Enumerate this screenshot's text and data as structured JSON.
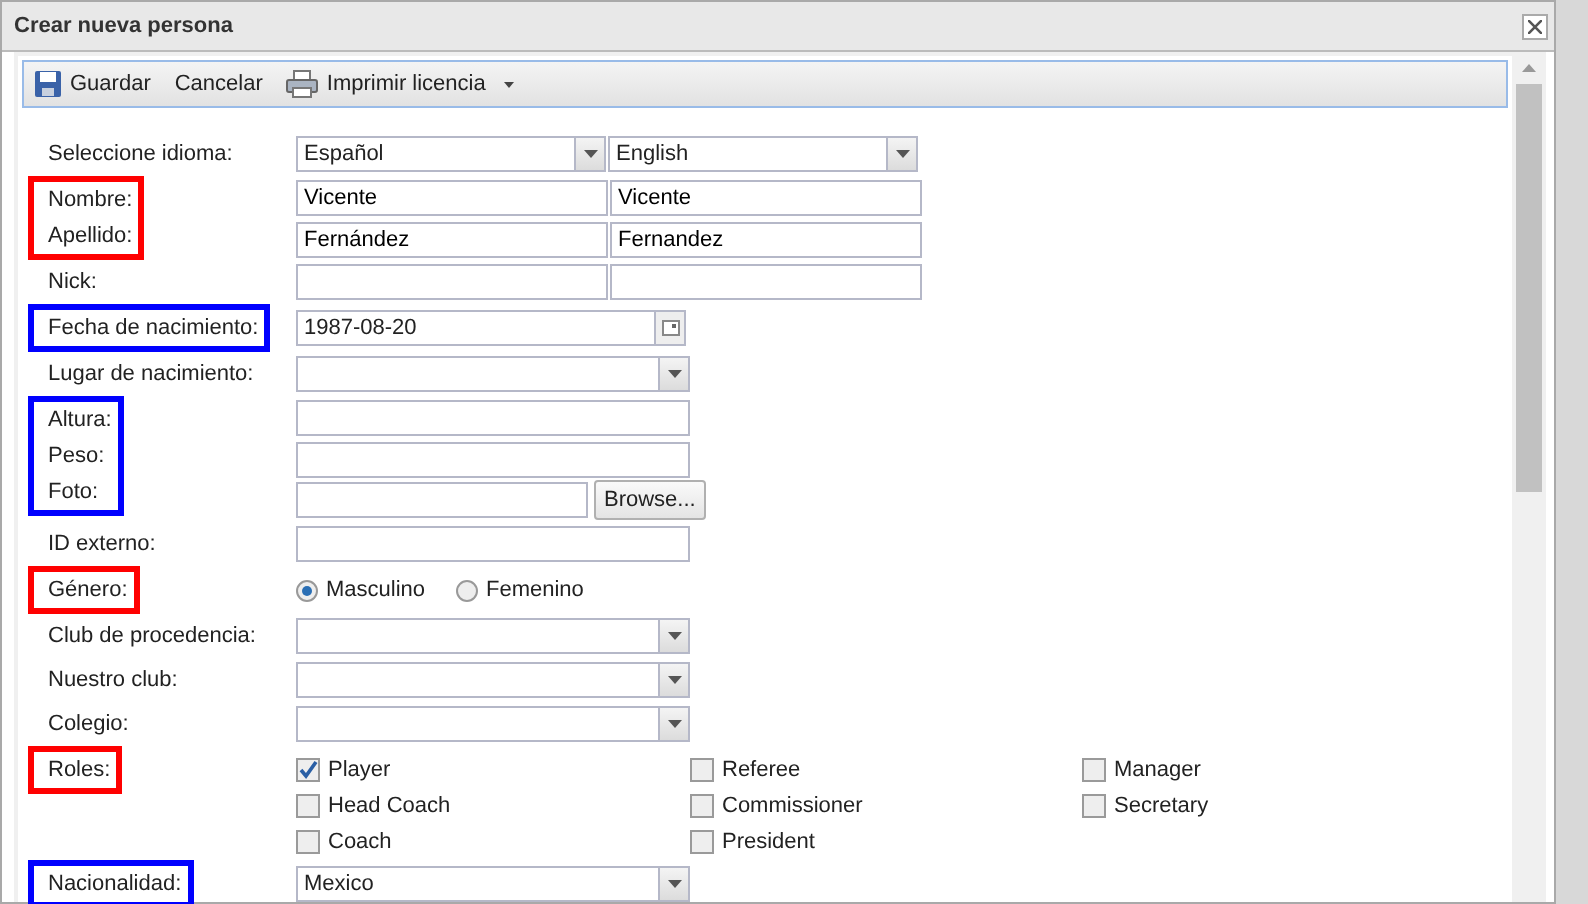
{
  "window": {
    "title": "Crear nueva persona"
  },
  "toolbar": [
    {
      "kind": "save",
      "label": "Guardar"
    },
    {
      "kind": "plain",
      "label": "Cancelar"
    },
    {
      "kind": "print",
      "label": "Imprimir licencia",
      "menu": true
    }
  ],
  "groups": [
    {
      "rows": [
        {
          "label": "Seleccione idioma:",
          "kind": "select-pair",
          "values": [
            "Español",
            "English"
          ]
        }
      ]
    },
    {
      "color": "#ff0000",
      "rows": [
        {
          "label": "Nombre:",
          "kind": "text-pair",
          "values": [
            "Vicente",
            "Vicente"
          ]
        },
        {
          "label": "Apellido:",
          "kind": "text-pair",
          "values": [
            "Fernández",
            "Fernandez"
          ]
        }
      ]
    },
    {
      "rows": [
        {
          "label": "Nick:",
          "kind": "text-pair"
        }
      ]
    },
    {
      "color": "#0000ff",
      "rows": [
        {
          "label": "Fecha de nacimiento:",
          "kind": "date",
          "value": "1987-08-20"
        }
      ]
    },
    {
      "rows": [
        {
          "label": "Lugar de nacimiento:",
          "kind": "select"
        }
      ]
    },
    {
      "color": "#0000ff",
      "rows": [
        {
          "label": "Altura:",
          "kind": "text"
        },
        {
          "label": "Peso:",
          "kind": "text"
        },
        {
          "label": "Foto:",
          "kind": "file",
          "button": "Browse..."
        }
      ]
    },
    {
      "rows": [
        {
          "label": "ID externo:",
          "kind": "text"
        }
      ]
    },
    {
      "color": "#ff0000",
      "rows": [
        {
          "label": "Género:",
          "kind": "radio",
          "options": [
            {
              "label": "Masculino",
              "selected": true
            },
            {
              "label": "Femenino",
              "selected": false
            }
          ]
        }
      ]
    },
    {
      "rows": [
        {
          "label": "Club de procedencia:",
          "kind": "select"
        }
      ]
    },
    {
      "rows": [
        {
          "label": "Nuestro club:",
          "kind": "select"
        }
      ]
    },
    {
      "rows": [
        {
          "label": "Colegio:",
          "kind": "select"
        }
      ]
    },
    {
      "color": "#ff0000",
      "rows": [
        {
          "label": "Roles:",
          "kind": "checkboxes",
          "options": [
            {
              "label": "Player",
              "checked": true
            },
            {
              "label": "Head Coach",
              "checked": false
            },
            {
              "label": "Coach",
              "checked": false
            },
            {
              "label": "Referee",
              "checked": false
            },
            {
              "label": "Commissioner",
              "checked": false
            },
            {
              "label": "President",
              "checked": false
            },
            {
              "label": "Manager",
              "checked": false
            },
            {
              "label": "Secretary",
              "checked": false
            }
          ]
        }
      ]
    },
    {
      "color": "#0000ff",
      "rows": [
        {
          "label": "Nacionalidad:",
          "kind": "select",
          "value": "Mexico"
        }
      ]
    }
  ]
}
